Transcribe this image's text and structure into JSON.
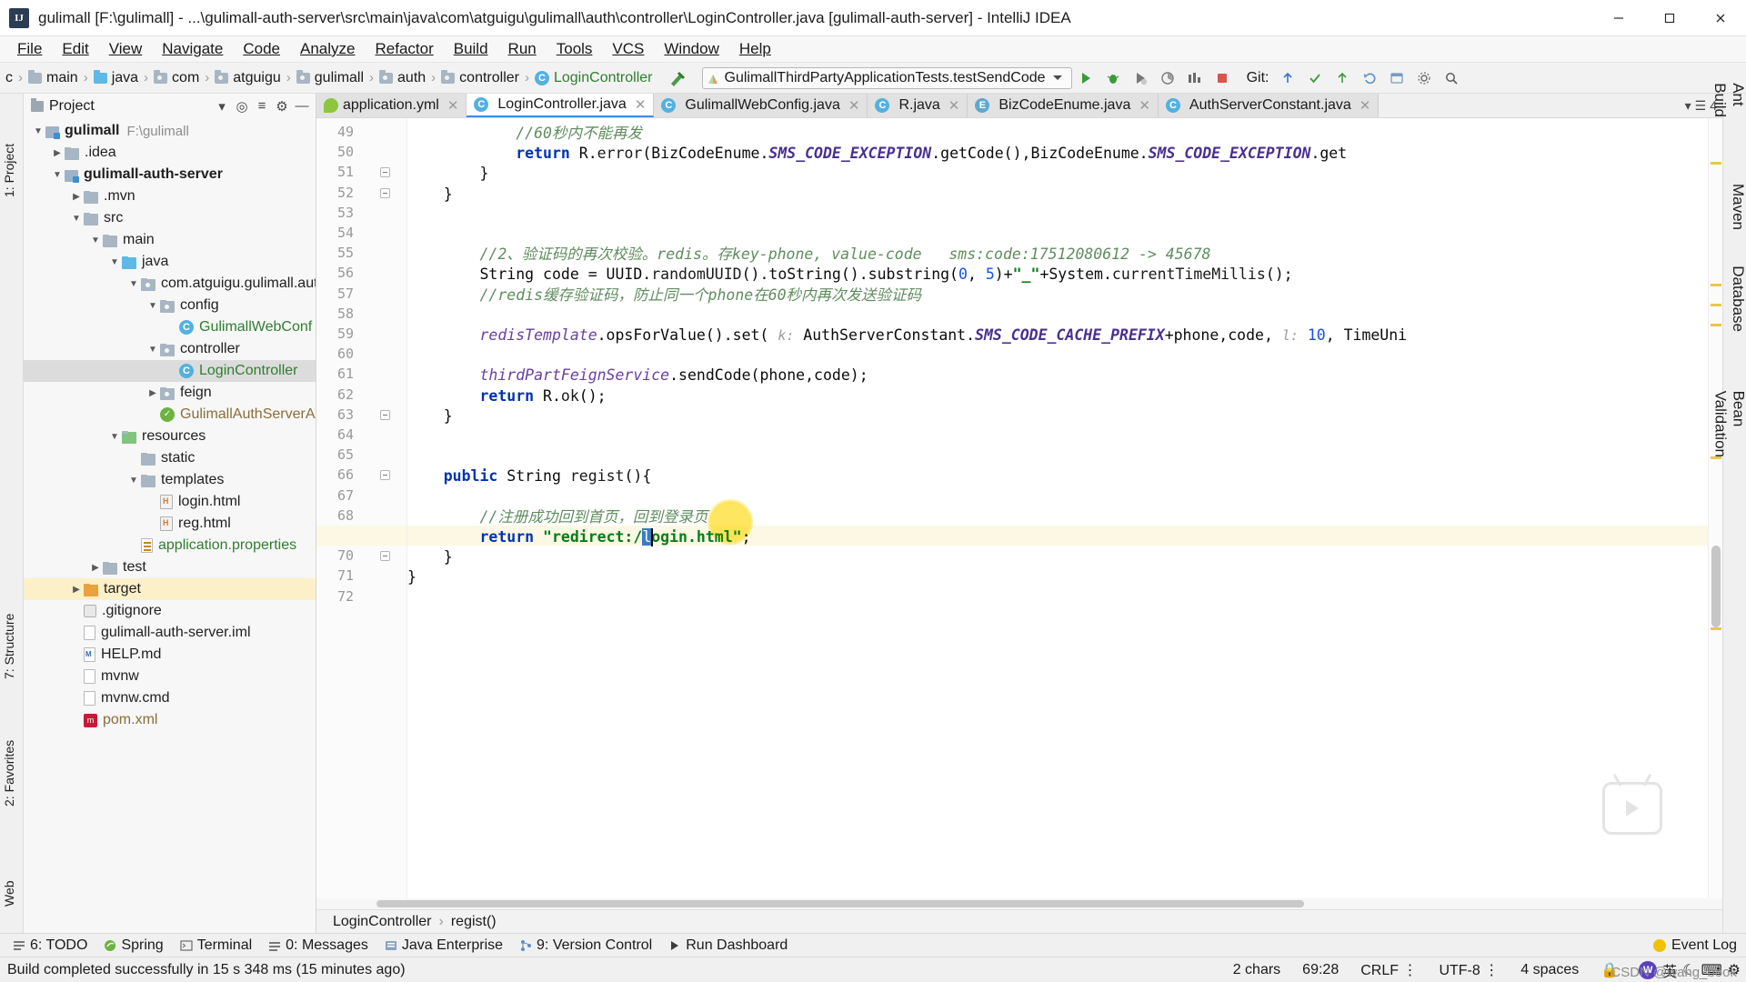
{
  "window": {
    "title": "gulimall [F:\\gulimall] - ...\\gulimall-auth-server\\src\\main\\java\\com\\atguigu\\gulimall\\auth\\controller\\LoginController.java [gulimall-auth-server] - IntelliJ IDEA",
    "app_badge": "IJ",
    "minimize": "—",
    "maximize": "☐",
    "close": "✕"
  },
  "menubar": [
    {
      "label": "File"
    },
    {
      "label": "Edit"
    },
    {
      "label": "View"
    },
    {
      "label": "Navigate"
    },
    {
      "label": "Code"
    },
    {
      "label": "Analyze"
    },
    {
      "label": "Refactor"
    },
    {
      "label": "Build"
    },
    {
      "label": "Run"
    },
    {
      "label": "Tools"
    },
    {
      "label": "VCS"
    },
    {
      "label": "Window"
    },
    {
      "label": "Help"
    }
  ],
  "navbar": {
    "crumbs": [
      {
        "label": "c",
        "icon": "none"
      },
      {
        "label": "main",
        "icon": "folder"
      },
      {
        "label": "java",
        "icon": "folder-blue"
      },
      {
        "label": "com",
        "icon": "folder-src"
      },
      {
        "label": "atguigu",
        "icon": "folder-src"
      },
      {
        "label": "gulimall",
        "icon": "folder-src"
      },
      {
        "label": "auth",
        "icon": "folder-src"
      },
      {
        "label": "controller",
        "icon": "folder-src"
      },
      {
        "label": "LoginController",
        "icon": "class-icon"
      }
    ],
    "run_config": "GulimallThirdPartyApplicationTests.testSendCode",
    "git_label": "Git:",
    "buttons": [
      {
        "name": "run-button",
        "glyph": "▶"
      },
      {
        "name": "debug-button",
        "glyph": "🐞"
      },
      {
        "name": "run-with-coverage-button",
        "glyph": "▶"
      },
      {
        "name": "profile-button",
        "glyph": "◔"
      },
      {
        "name": "stop-button",
        "glyph": "■"
      }
    ]
  },
  "project": {
    "title": "Project",
    "tree": [
      {
        "depth": 0,
        "arrow": "▼",
        "icon": "mod",
        "label": "gulimall",
        "bold": true,
        "suffix": "F:\\gulimall"
      },
      {
        "depth": 1,
        "arrow": "▶",
        "icon": "folder",
        "label": ".idea"
      },
      {
        "depth": 1,
        "arrow": "▼",
        "icon": "mod",
        "label": "gulimall-auth-server",
        "bold": true
      },
      {
        "depth": 2,
        "arrow": "▶",
        "icon": "folder",
        "label": ".mvn"
      },
      {
        "depth": 2,
        "arrow": "▼",
        "icon": "folder",
        "label": "src"
      },
      {
        "depth": 3,
        "arrow": "▼",
        "icon": "folder",
        "label": "main"
      },
      {
        "depth": 4,
        "arrow": "▼",
        "icon": "folder-blue",
        "label": "java"
      },
      {
        "depth": 5,
        "arrow": "▼",
        "icon": "folder-src",
        "label": "com.atguigu.gulimall.aut"
      },
      {
        "depth": 6,
        "arrow": "▼",
        "icon": "folder-src",
        "label": "config"
      },
      {
        "depth": 7,
        "arrow": "",
        "icon": "class",
        "label": "GulimallWebConf",
        "green": true
      },
      {
        "depth": 6,
        "arrow": "▼",
        "icon": "folder-src",
        "label": "controller"
      },
      {
        "depth": 7,
        "arrow": "",
        "icon": "class",
        "label": "LoginController",
        "green": true,
        "selected": true
      },
      {
        "depth": 6,
        "arrow": "▶",
        "icon": "folder-src",
        "label": "feign"
      },
      {
        "depth": 6,
        "arrow": "",
        "icon": "spring",
        "label": "GulimallAuthServerAp",
        "brown": true
      },
      {
        "depth": 4,
        "arrow": "▼",
        "icon": "folder-res",
        "label": "resources"
      },
      {
        "depth": 5,
        "arrow": "",
        "icon": "folder",
        "label": "static"
      },
      {
        "depth": 5,
        "arrow": "▼",
        "icon": "folder",
        "label": "templates"
      },
      {
        "depth": 6,
        "arrow": "",
        "icon": "html",
        "label": "login.html"
      },
      {
        "depth": 6,
        "arrow": "",
        "icon": "html",
        "label": "reg.html"
      },
      {
        "depth": 5,
        "arrow": "",
        "icon": "prop",
        "label": "application.properties",
        "green": true
      },
      {
        "depth": 3,
        "arrow": "▶",
        "icon": "folder",
        "label": "test"
      },
      {
        "depth": 2,
        "arrow": "▶",
        "icon": "folder-orange",
        "label": "target",
        "highlight": true
      },
      {
        "depth": 2,
        "arrow": "",
        "icon": "git",
        "label": ".gitignore"
      },
      {
        "depth": 2,
        "arrow": "",
        "icon": "file",
        "label": "gulimall-auth-server.iml"
      },
      {
        "depth": 2,
        "arrow": "",
        "icon": "md",
        "label": "HELP.md"
      },
      {
        "depth": 2,
        "arrow": "",
        "icon": "file",
        "label": "mvnw"
      },
      {
        "depth": 2,
        "arrow": "",
        "icon": "file",
        "label": "mvnw.cmd"
      },
      {
        "depth": 2,
        "arrow": "",
        "icon": "maven",
        "label": "pom.xml",
        "brown": true
      }
    ]
  },
  "left_rail": [
    {
      "label": "1: Project"
    },
    {
      "label": "7: Structure"
    },
    {
      "label": "2: Favorites"
    },
    {
      "label": "Web"
    }
  ],
  "right_rail": [
    {
      "label": "Ant Build"
    },
    {
      "label": "Maven"
    },
    {
      "label": "Database"
    },
    {
      "label": "Bean Validation"
    }
  ],
  "tabs": [
    {
      "label": "application.yml",
      "icon": "yml-icon",
      "active": false
    },
    {
      "label": "LoginController.java",
      "icon": "class-icon",
      "active": true
    },
    {
      "label": "GulimallWebConfig.java",
      "icon": "class-icon",
      "active": false
    },
    {
      "label": "R.java",
      "icon": "class-icon",
      "active": false
    },
    {
      "label": "BizCodeEnume.java",
      "icon": "enum-icon",
      "active": false
    },
    {
      "label": "AuthServerConstant.java",
      "icon": "class-icon",
      "active": false
    }
  ],
  "tabs_right_badge": "4",
  "editor": {
    "first_line": 49,
    "lines": [
      {
        "n": 49,
        "tokens": [
          {
            "t": "            ",
            "c": "plain"
          },
          {
            "t": "//60秒内不能再发",
            "c": "cmtg"
          }
        ]
      },
      {
        "n": 50,
        "tokens": [
          {
            "t": "            ",
            "c": "plain"
          },
          {
            "t": "return",
            "c": "kw"
          },
          {
            "t": " R.",
            "c": "plain"
          },
          {
            "t": "error",
            "c": "meth"
          },
          {
            "t": "(BizCodeEnume.",
            "c": "plain"
          },
          {
            "t": "SMS_CODE_EXCEPTION",
            "c": "stat"
          },
          {
            "t": ".getCode(),BizCodeEnume.",
            "c": "plain"
          },
          {
            "t": "SMS_CODE_EXCEPTION",
            "c": "stat"
          },
          {
            "t": ".get",
            "c": "plain"
          }
        ]
      },
      {
        "n": 51,
        "tokens": [
          {
            "t": "        }",
            "c": "plain"
          }
        ],
        "fold": true
      },
      {
        "n": 52,
        "tokens": [
          {
            "t": "    }",
            "c": "plain"
          }
        ],
        "fold": true
      },
      {
        "n": 53,
        "tokens": []
      },
      {
        "n": 54,
        "tokens": []
      },
      {
        "n": 55,
        "tokens": [
          {
            "t": "        ",
            "c": "plain"
          },
          {
            "t": "//2、验证码的再次校验。redis。存key-phone, value-code   sms:code:17512080612 -> 45678",
            "c": "cmtg"
          }
        ]
      },
      {
        "n": 56,
        "tokens": [
          {
            "t": "        ",
            "c": "plain"
          },
          {
            "t": "String code = UUID.",
            "c": "plain"
          },
          {
            "t": "randomUUID",
            "c": "meth"
          },
          {
            "t": "().toString().substring(",
            "c": "plain"
          },
          {
            "t": "0",
            "c": "num"
          },
          {
            "t": ", ",
            "c": "plain"
          },
          {
            "t": "5",
            "c": "num"
          },
          {
            "t": ")+",
            "c": "plain"
          },
          {
            "t": "\"_\"",
            "c": "str"
          },
          {
            "t": "+System.",
            "c": "plain"
          },
          {
            "t": "currentTimeMillis",
            "c": "meth"
          },
          {
            "t": "();",
            "c": "plain"
          }
        ]
      },
      {
        "n": 57,
        "tokens": [
          {
            "t": "        ",
            "c": "plain"
          },
          {
            "t": "//redis缓存验证码，防止同一个phone在60秒内再次发送验证码",
            "c": "cmtg"
          }
        ]
      },
      {
        "n": 58,
        "tokens": []
      },
      {
        "n": 59,
        "tokens": [
          {
            "t": "        ",
            "c": "plain"
          },
          {
            "t": "redisTemplate",
            "c": "fld"
          },
          {
            "t": ".opsForValue().set( ",
            "c": "plain"
          },
          {
            "t": "k:",
            "c": "hint"
          },
          {
            "t": " AuthServerConstant.",
            "c": "plain"
          },
          {
            "t": "SMS_CODE_CACHE_PREFIX",
            "c": "stat"
          },
          {
            "t": "+phone,code, ",
            "c": "plain"
          },
          {
            "t": "l:",
            "c": "hint"
          },
          {
            "t": " ",
            "c": "plain"
          },
          {
            "t": "10",
            "c": "num"
          },
          {
            "t": ", TimeUni",
            "c": "plain"
          }
        ]
      },
      {
        "n": 60,
        "tokens": []
      },
      {
        "n": 61,
        "tokens": [
          {
            "t": "        ",
            "c": "plain"
          },
          {
            "t": "thirdPartFeignService",
            "c": "fld"
          },
          {
            "t": ".sendCode(phone,code);",
            "c": "plain"
          }
        ]
      },
      {
        "n": 62,
        "tokens": [
          {
            "t": "        ",
            "c": "plain"
          },
          {
            "t": "return",
            "c": "kw"
          },
          {
            "t": " R.",
            "c": "plain"
          },
          {
            "t": "ok",
            "c": "meth"
          },
          {
            "t": "();",
            "c": "plain"
          }
        ]
      },
      {
        "n": 63,
        "tokens": [
          {
            "t": "    }",
            "c": "plain"
          }
        ],
        "fold": true
      },
      {
        "n": 64,
        "tokens": []
      },
      {
        "n": 65,
        "tokens": []
      },
      {
        "n": 66,
        "tokens": [
          {
            "t": "    ",
            "c": "plain"
          },
          {
            "t": "public",
            "c": "kw"
          },
          {
            "t": " String ",
            "c": "plain"
          },
          {
            "t": "regist",
            "c": "meth"
          },
          {
            "t": "(){",
            "c": "plain"
          }
        ],
        "fold": true
      },
      {
        "n": 67,
        "tokens": []
      },
      {
        "n": 68,
        "tokens": [
          {
            "t": "        ",
            "c": "plain"
          },
          {
            "t": "//注册成功回到首页，回到登录页",
            "c": "cmtg"
          }
        ]
      },
      {
        "n": 69,
        "tokens": [
          {
            "t": "        ",
            "c": "plain"
          },
          {
            "t": "return",
            "c": "kw"
          },
          {
            "t": " ",
            "c": "plain"
          },
          {
            "t": "\"redirect:/",
            "c": "str"
          },
          {
            "t": "l",
            "c": "sel"
          },
          {
            "t": "ogin.html\"",
            "c": "str"
          },
          {
            "t": ";",
            "c": "plain"
          }
        ],
        "current": true
      },
      {
        "n": 70,
        "tokens": [
          {
            "t": "    }",
            "c": "plain"
          }
        ],
        "fold": true
      },
      {
        "n": 71,
        "tokens": [
          {
            "t": "}",
            "c": "plain"
          }
        ]
      },
      {
        "n": 72,
        "tokens": []
      }
    ]
  },
  "editor_breadcrumb": [
    "LoginController",
    "regist()"
  ],
  "bottom_tools": [
    {
      "label": "6: TODO",
      "icon": "todo-icon"
    },
    {
      "label": "Spring",
      "icon": "spring-icon"
    },
    {
      "label": "Terminal",
      "icon": "terminal-icon"
    },
    {
      "label": "0: Messages",
      "icon": "messages-icon"
    },
    {
      "label": "Java Enterprise",
      "icon": "java-ee-icon"
    },
    {
      "label": "9: Version Control",
      "icon": "vcs-icon"
    },
    {
      "label": "Run Dashboard",
      "icon": "run-dashboard-icon"
    }
  ],
  "event_log": "Event Log",
  "statusbar": {
    "message": "Build completed successfully in 15 s 348 ms (15 minutes ago)",
    "chars": "2 chars",
    "position": "69:28",
    "line_sep": "CRLF",
    "encoding": "UTF-8",
    "indent": "4 spaces",
    "ime_mode": "英",
    "lock": "🔒"
  },
  "watermark_credit": "CSDN @wang_book"
}
